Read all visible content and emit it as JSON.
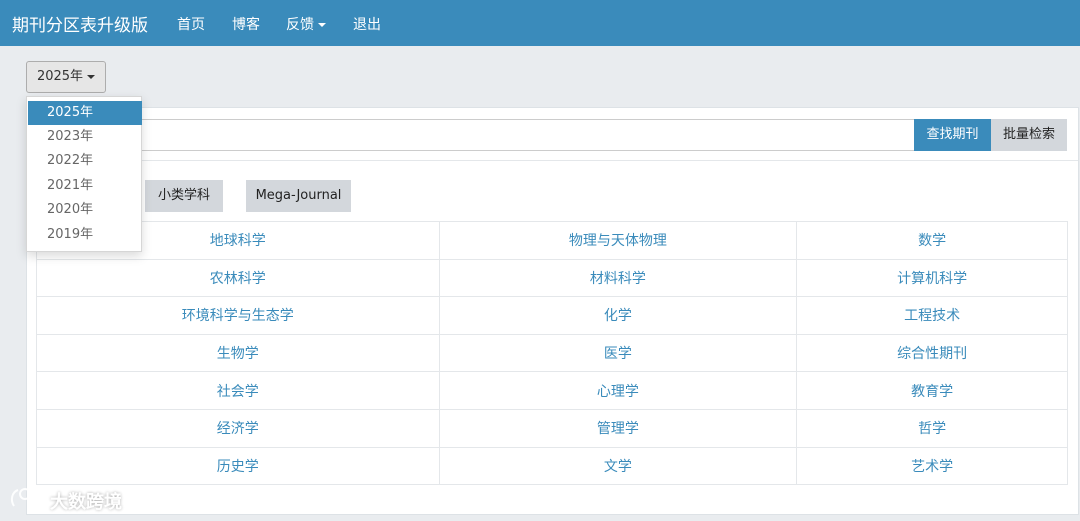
{
  "navbar": {
    "brand": "期刊分区表升级版",
    "items": [
      {
        "label": "首页"
      },
      {
        "label": "博客"
      },
      {
        "label": "反馈"
      },
      {
        "label": "退出"
      }
    ]
  },
  "year_selector": {
    "selected": "2025年",
    "options": [
      "2025年",
      "2023年",
      "2022年",
      "2021年",
      "2020年",
      "2019年"
    ]
  },
  "search": {
    "placeholder_visible": "N",
    "find_button": "查找期刊",
    "batch_button": "批量检索"
  },
  "category_tabs": [
    "小类学科",
    "Mega-Journal"
  ],
  "subjects": [
    [
      "地球科学",
      "物理与天体物理",
      "数学"
    ],
    [
      "农林科学",
      "材料科学",
      "计算机科学"
    ],
    [
      "环境科学与生态学",
      "化学",
      "工程技术"
    ],
    [
      "生物学",
      "医学",
      "综合性期刊"
    ],
    [
      "社会学",
      "心理学",
      "教育学"
    ],
    [
      "经济学",
      "管理学",
      "哲学"
    ],
    [
      "历史学",
      "文学",
      "艺术学"
    ]
  ],
  "watermark": "大数跨境",
  "colors": {
    "primary": "#3a8bbb",
    "button_gray": "#d3d7dc"
  }
}
